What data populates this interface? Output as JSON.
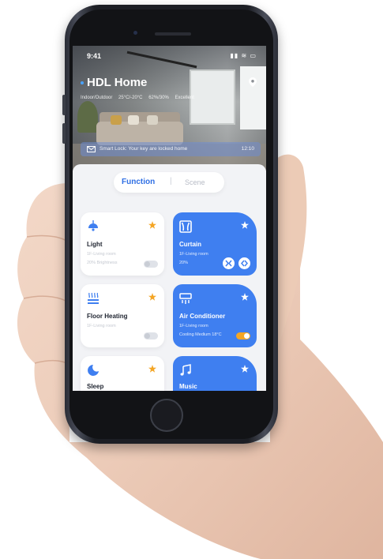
{
  "status_bar": {
    "time": "9:41",
    "icons": "▮▮ ≋ ▭"
  },
  "header": {
    "title": "HDL Home",
    "env": [
      "Indoor/Outdoor",
      "25°C/-20°C",
      "62%/30%",
      "Excellent"
    ]
  },
  "notice": {
    "message": "Smart Lock: Your key are locked home",
    "time": "12:10"
  },
  "tabs": {
    "function": "Function",
    "separator": "|",
    "scene": "Scene"
  },
  "cards": [
    {
      "name": "Light",
      "room": "1F-Living room",
      "state": "20% Brightness",
      "icon": "ceiling-light-icon",
      "style": "white",
      "control": "toggle-off"
    },
    {
      "name": "Curtain",
      "room": "1F-Living room",
      "state": "20%",
      "icon": "curtain-icon",
      "style": "blue",
      "control": "close-open-buttons"
    },
    {
      "name": "Floor Heating",
      "room": "1F-Living room",
      "state": "",
      "icon": "floor-heating-icon",
      "style": "white",
      "control": "toggle-off"
    },
    {
      "name": "Air Conditioner",
      "room": "1F-Living room",
      "state": "Cooling Medium 18°C",
      "icon": "air-conditioner-icon",
      "style": "blue",
      "control": "toggle-on"
    },
    {
      "name": "Sleep",
      "room": "",
      "state": "",
      "icon": "moon-icon",
      "style": "white",
      "control": ""
    },
    {
      "name": "Music",
      "room": "",
      "state": "",
      "icon": "music-note-icon",
      "style": "blue",
      "control": ""
    }
  ],
  "colors": {
    "accent": "#3f7ff0",
    "star": "#f4a524",
    "toggle_on": "#f4a524",
    "panel_bg": "#f2f3f6"
  }
}
